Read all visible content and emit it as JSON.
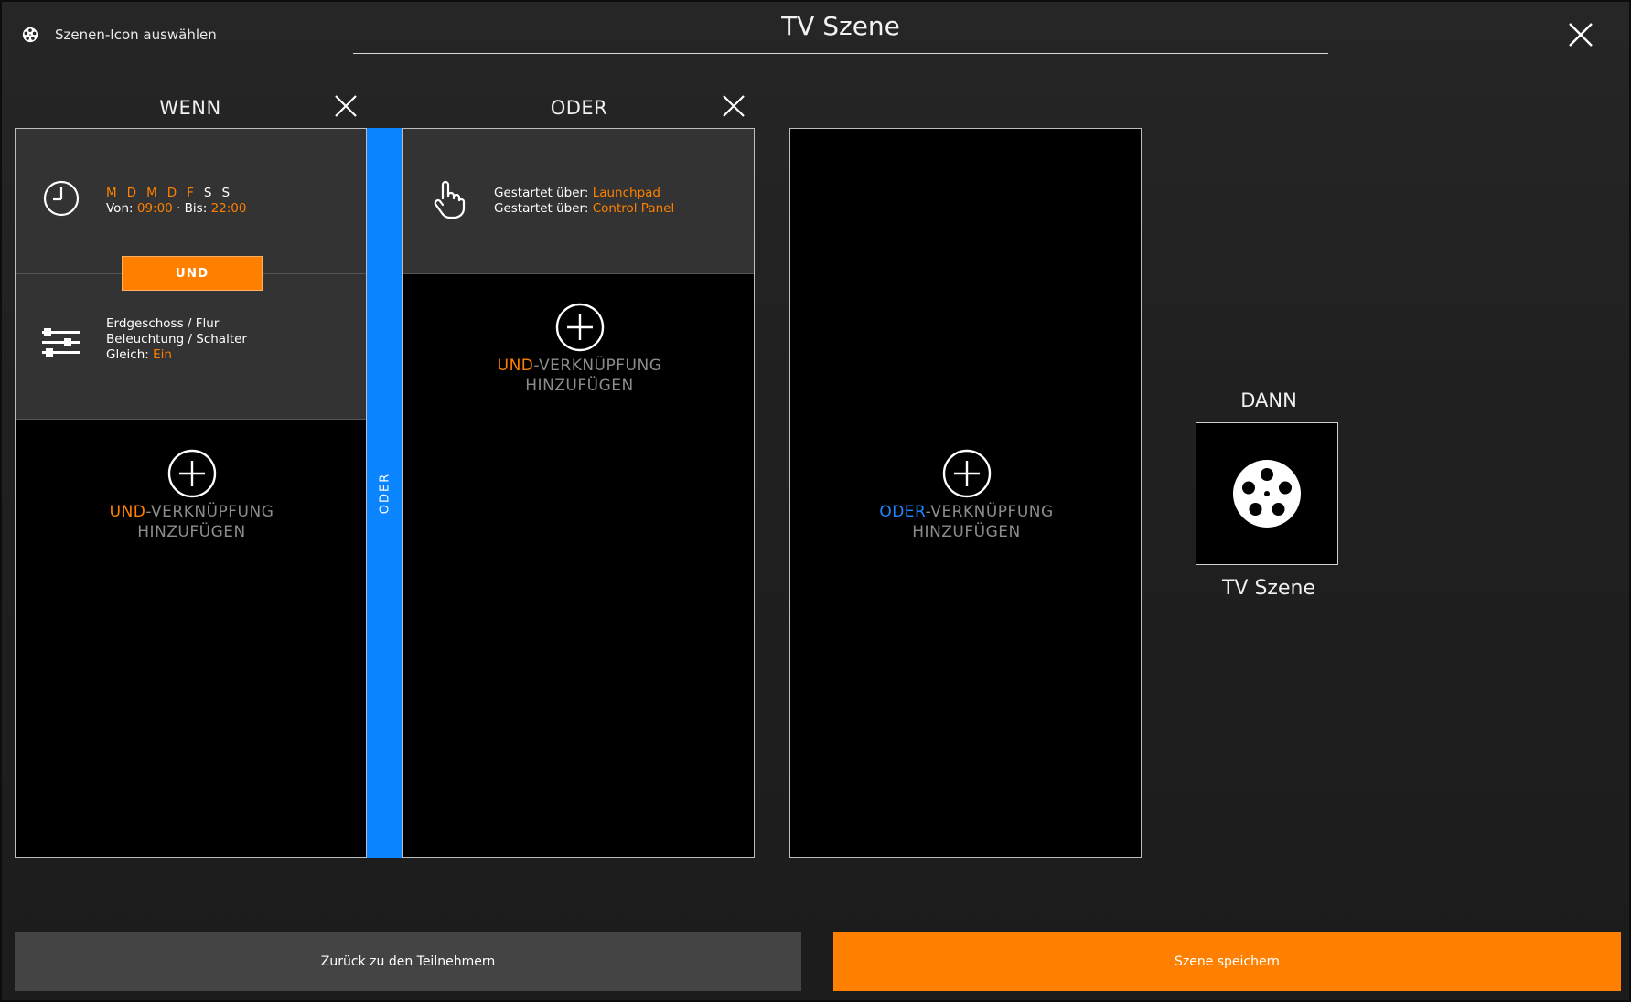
{
  "header": {
    "icon_select_label": "Szenen-Icon auswählen",
    "title": "TV Szene"
  },
  "wenn": {
    "heading": "WENN",
    "time_card": {
      "days": [
        "M",
        "D",
        "M",
        "D",
        "F",
        "S",
        "S"
      ],
      "von_label": "Von:",
      "von_value": "09:00",
      "separator": "·",
      "bis_label": "Bis:",
      "bis_value": "22:00"
    },
    "und_label": "UND",
    "device_card": {
      "line1": "Erdgeschoss / Flur",
      "line2": "Beleuchtung / Schalter",
      "condition_label": "Gleich:",
      "condition_value": "Ein"
    },
    "add": {
      "prefix": "UND",
      "suffix": "-VERKNÜPFUNG",
      "line2": "HINZUFÜGEN"
    }
  },
  "oder_bar_label": "ODER",
  "oder": {
    "heading": "ODER",
    "launch_card": {
      "label1": "Gestartet über:",
      "value1": "Launchpad",
      "label2": "Gestartet über:",
      "value2": "Control Panel"
    },
    "add": {
      "prefix": "UND",
      "suffix": "-VERKNÜPFUNG",
      "line2": "HINZUFÜGEN"
    }
  },
  "oder_add": {
    "prefix": "ODER",
    "suffix": "-VERKNÜPFUNG",
    "line2": "HINZUFÜGEN"
  },
  "dann": {
    "heading": "DANN",
    "scene_name": "TV Szene"
  },
  "footer": {
    "back_label": "Zurück zu den Teilnehmern",
    "save_label": "Szene speichern"
  },
  "colors": {
    "accent_orange": "#ff8000",
    "accent_blue": "#0a84ff",
    "panel_bg": "#000000",
    "card_bg": "#333333"
  }
}
